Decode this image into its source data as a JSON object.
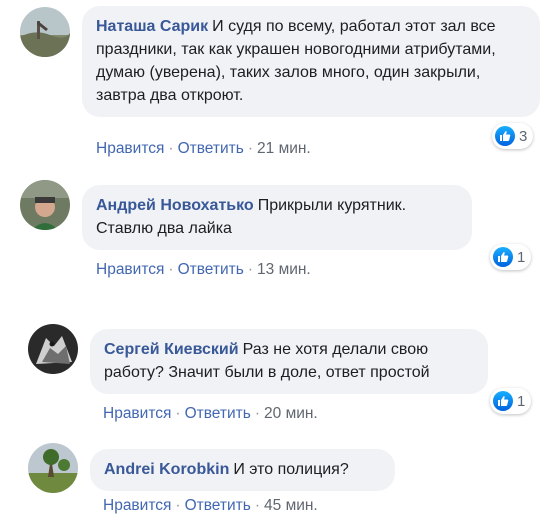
{
  "comments": [
    {
      "author": "Наташа Сарик",
      "text": "И судя по всему, работал этот зал все праздники, так как украшен новогодними атрибутами, думаю (уверена), таких залов много, один закрыли, завтра два откроют.",
      "like_label": "Нравится",
      "reply_label": "Ответить",
      "time": "21 мин.",
      "reactions": "3"
    },
    {
      "author": "Андрей Новохатько",
      "text": "Прикрыли курятник. Ставлю два лайка",
      "like_label": "Нравится",
      "reply_label": "Ответить",
      "time": "13 мин.",
      "reactions": "1"
    },
    {
      "author": "Сергей Киевский",
      "text": "Раз не хотя делали свою работу? Значит были в доле, ответ простой",
      "like_label": "Нравится",
      "reply_label": "Ответить",
      "time": "20 мин.",
      "reactions": "1"
    },
    {
      "author": "Andrei Korobkin",
      "text": "И это полиция?",
      "like_label": "Нравится",
      "reply_label": "Ответить",
      "time": "45 мин."
    }
  ],
  "separator": "·",
  "icons": {
    "like": "thumbs-up-icon"
  },
  "colors": {
    "author": "#385898",
    "link": "#4267b2",
    "bubble": "#f0f2f5",
    "like": "#1877f2"
  }
}
